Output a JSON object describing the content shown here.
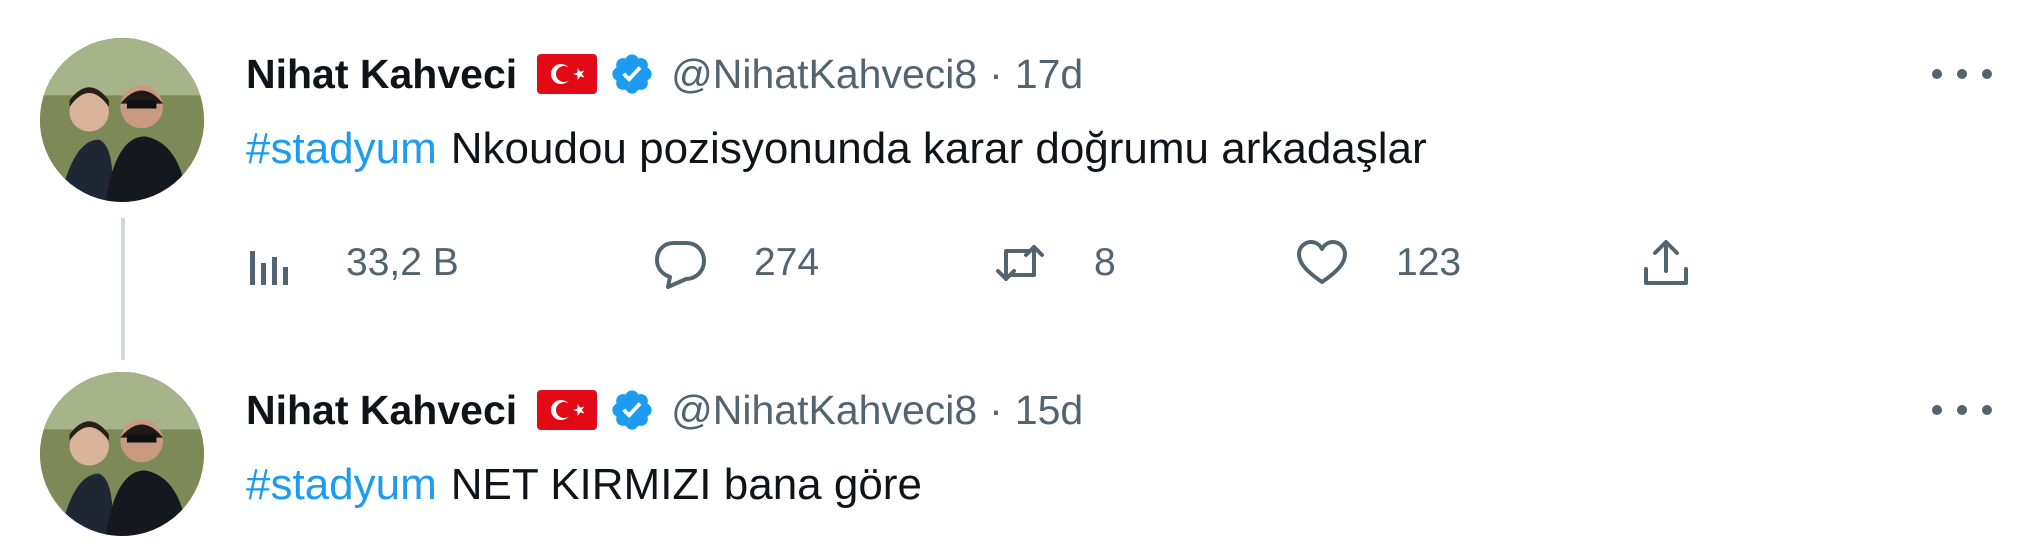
{
  "tweets": [
    {
      "author_name": "Nihat Kahveci",
      "handle": "@NihatKahveci8",
      "separator": "·",
      "time": "17d",
      "hashtag": "#stadyum",
      "text": "Nkoudou pozisyonunda karar doğrumu arkadaşlar",
      "stats": {
        "views": "33,2 B",
        "replies": "274",
        "retweets": "8",
        "likes": "123"
      }
    },
    {
      "author_name": "Nihat Kahveci",
      "handle": "@NihatKahveci8",
      "separator": "·",
      "time": "15d",
      "hashtag": "#stadyum",
      "text": "NET KIRMIZI bana göre"
    }
  ],
  "icons": {
    "flag": "turkey-flag-icon",
    "verified": "verified-badge-icon",
    "more": "more-options-icon",
    "views": "analytics-icon",
    "reply": "reply-icon",
    "retweet": "retweet-icon",
    "like": "heart-icon",
    "share": "share-icon"
  },
  "colors": {
    "hashtag": "#1d9bf0",
    "verified": "#1d9bf0",
    "secondary_text": "#536471",
    "flag_red": "#e30a17",
    "thread_line": "#cfd9de"
  }
}
